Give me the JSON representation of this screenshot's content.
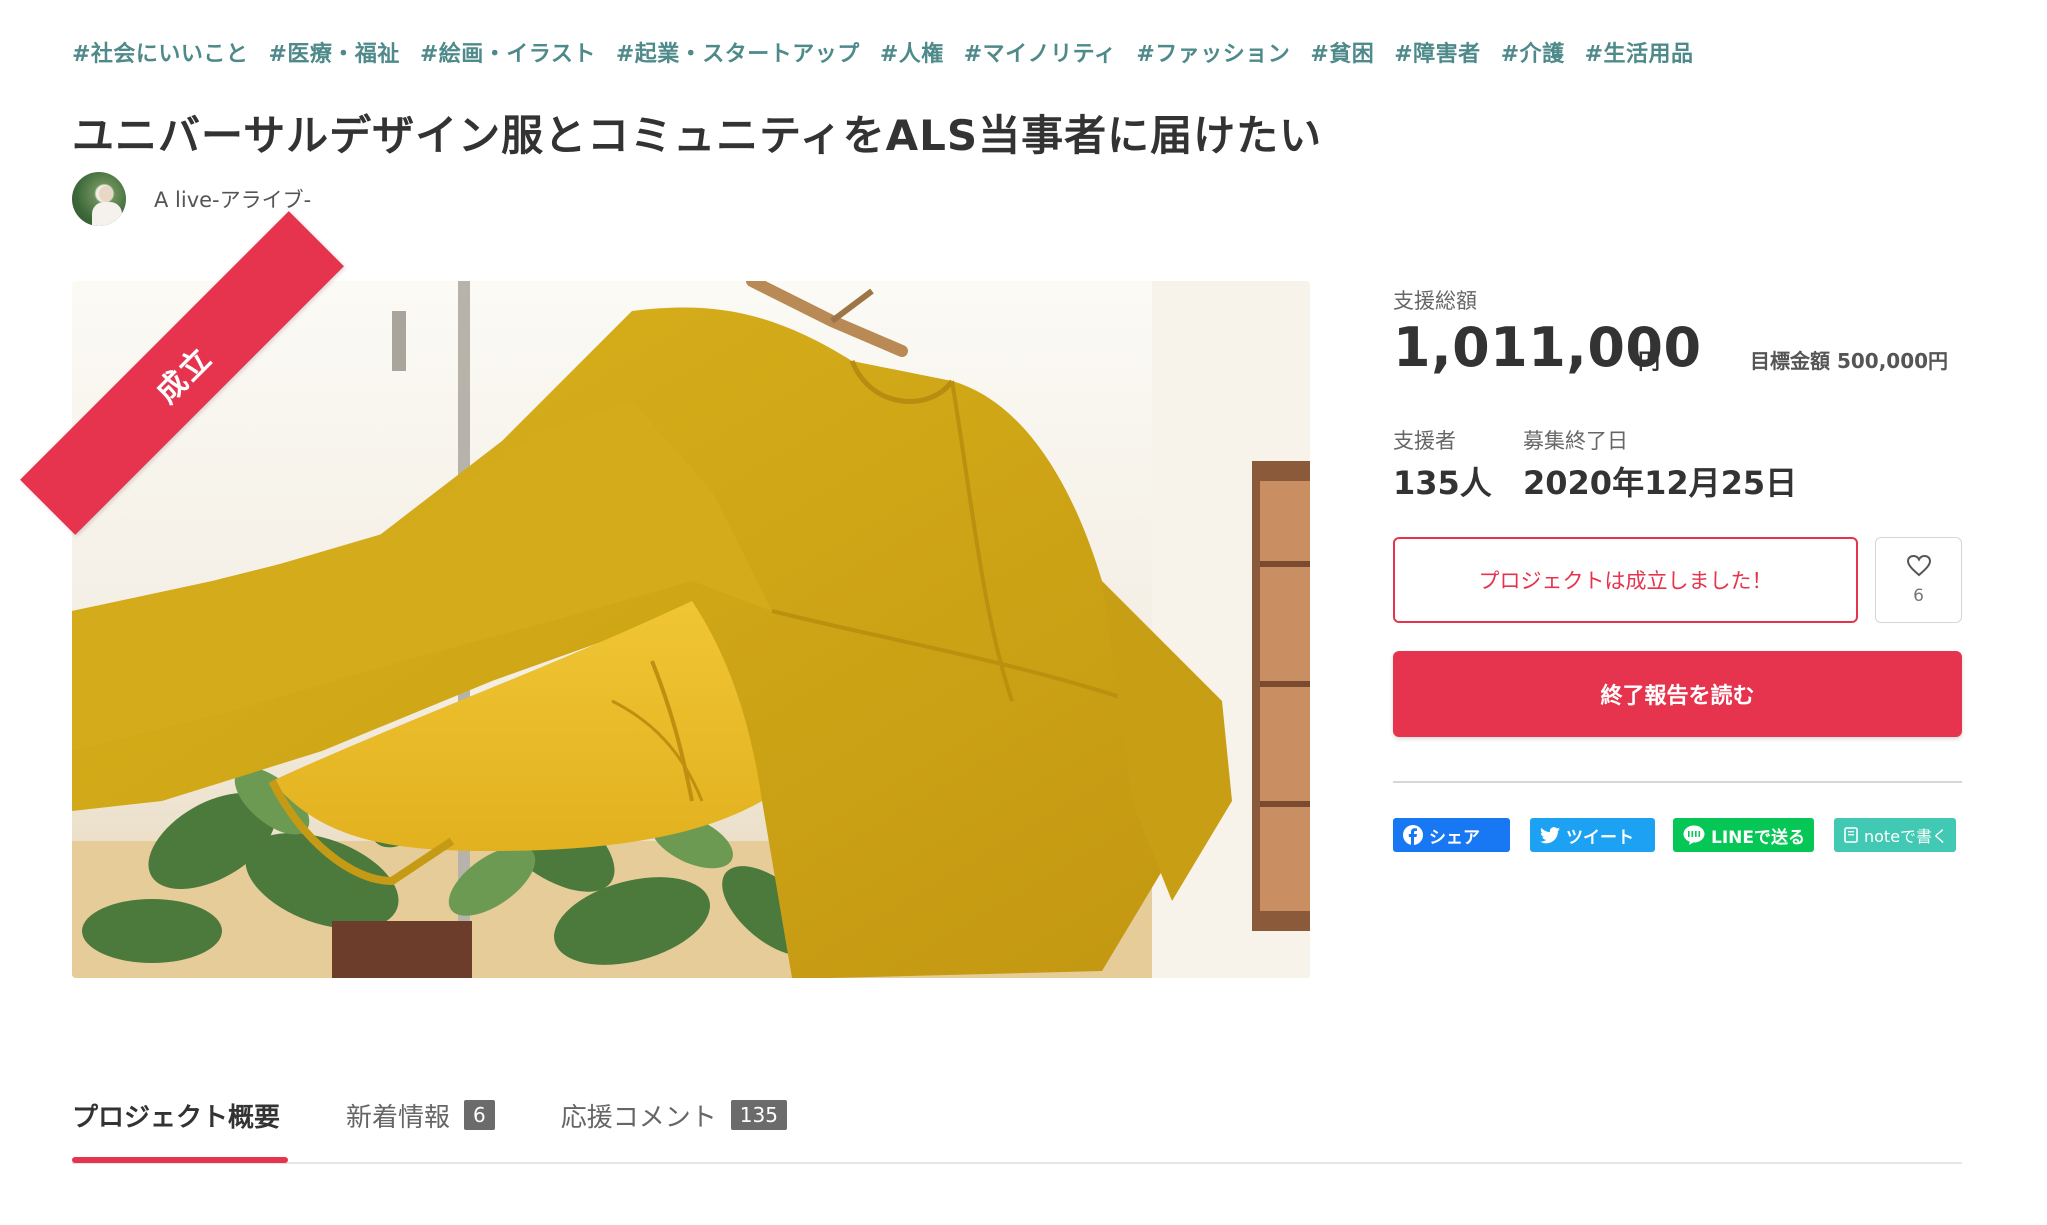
{
  "tags": [
    "#社会にいいこと",
    "#医療・福祉",
    "#絵画・イラスト",
    "#起業・スタートアップ",
    "#人権",
    "#マイノリティ",
    "#ファッション",
    "#貧困",
    "#障害者",
    "#介護",
    "#生活用品"
  ],
  "project": {
    "title": "ユニバーサルデザイン服とコミュニティをALS当事者に届けたい",
    "owner_name": "A live-アライブ-",
    "ribbon_label": "成立"
  },
  "stats": {
    "total_label": "支援総額",
    "total_value": "1,011,000",
    "total_unit": "円",
    "goal_text": "目標金額 500,000円",
    "supporters_label": "支援者",
    "supporters_value": "135人",
    "end_label": "募集終了日",
    "end_value": "2020年12月25日"
  },
  "actions": {
    "status_label": "プロジェクトは成立しました！",
    "favorite_count": "6",
    "report_label": "終了報告を読む"
  },
  "share": {
    "facebook": "シェア",
    "twitter": "ツイート",
    "line": "LINEで送る",
    "note": "noteで書く"
  },
  "tabs": [
    {
      "label": "プロジェクト概要",
      "badge": ""
    },
    {
      "label": "新着情報",
      "badge": "6"
    },
    {
      "label": "応援コメント",
      "badge": "135"
    }
  ],
  "colors": {
    "accent": "#e6344f",
    "tag": "#4f8a8b",
    "facebook": "#1877f2",
    "twitter": "#1da1f2",
    "line": "#06c755",
    "note": "#41c9b4"
  },
  "icons": {
    "favorite": "heart-icon",
    "facebook": "facebook-icon",
    "twitter": "twitter-bird-icon",
    "line": "line-chat-icon",
    "note": "note-icon"
  }
}
